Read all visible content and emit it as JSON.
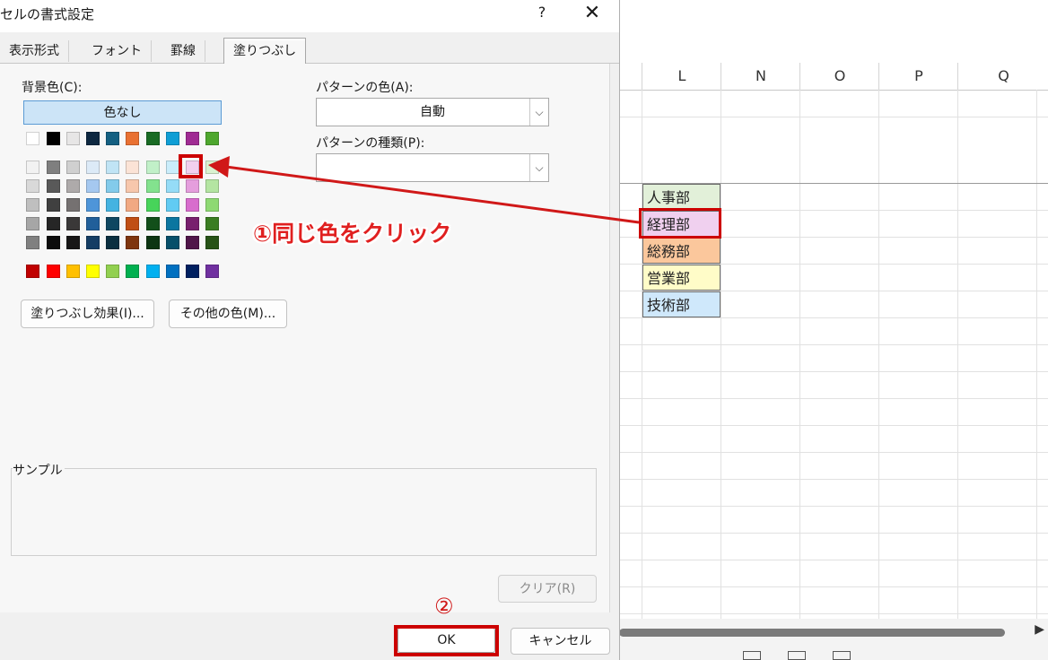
{
  "excel": {
    "columns": [
      "L",
      "N",
      "O",
      "P",
      "Q"
    ],
    "departments": [
      "人事部",
      "経理部",
      "総務部",
      "営業部",
      "技術部"
    ]
  },
  "dialog": {
    "title": "セルの書式設定",
    "help": "?",
    "close": "✕",
    "tabs": [
      "表示形式",
      "フォント",
      "罫線",
      "塗りつぶし"
    ],
    "active_tab": "塗りつぶし",
    "background_color_label": "背景色(C):",
    "no_color_button": "色なし",
    "pattern_color_label": "パターンの色(A):",
    "pattern_color_value": "自動",
    "pattern_style_label": "パターンの種類(P):",
    "pattern_style_value": "",
    "fill_effects_button": "塗りつぶし効果(I)...",
    "more_colors_button": "その他の色(M)...",
    "sample_label": "サンプル",
    "clear_button": "クリア(R)",
    "ok_button": "OK",
    "cancel_button": "キャンセル"
  },
  "palette": {
    "theme_row": [
      "#ffffff",
      "#000000",
      "#e7e6e6",
      "#0e2841",
      "#156082",
      "#e97132",
      "#196b24",
      "#0f9ed5",
      "#a02b93",
      "#4ea72e"
    ],
    "tint_rows": [
      [
        "#f2f2f2",
        "#7f7f7f",
        "#d0d0d0",
        "#dceaf7",
        "#c0e4f5",
        "#fbe3d6",
        "#c1f0c8",
        "#caedfb",
        "#f2cfee",
        "#d9f2d0"
      ],
      [
        "#d9d9d9",
        "#595959",
        "#aeaaaa",
        "#a5c8f0",
        "#83cbeb",
        "#f7c7ac",
        "#83e28e",
        "#95dcf7",
        "#e59edd",
        "#b4e5a2"
      ],
      [
        "#bfbfbf",
        "#404040",
        "#757171",
        "#4e95d9",
        "#44b3e1",
        "#f1a983",
        "#47d45a",
        "#61cbf3",
        "#d86dcd",
        "#8ed973"
      ],
      [
        "#a6a6a6",
        "#262626",
        "#3a3838",
        "#215f9a",
        "#0f4761",
        "#c04f15",
        "#124f1a",
        "#0b76a0",
        "#78206e",
        "#3a7d22"
      ],
      [
        "#808080",
        "#0d0d0d",
        "#171616",
        "#153d64",
        "#0a2f40",
        "#7f350e",
        "#0d3512",
        "#064f6a",
        "#501549",
        "#275317"
      ]
    ],
    "standard_row": [
      "#c00000",
      "#ff0000",
      "#ffc000",
      "#ffff00",
      "#92d050",
      "#00b050",
      "#00b0f0",
      "#0070c0",
      "#002060",
      "#7030a0"
    ]
  },
  "annotations": {
    "step1": "①同じ色をクリック",
    "step2": "②",
    "highlight_color": "#cc0000"
  }
}
